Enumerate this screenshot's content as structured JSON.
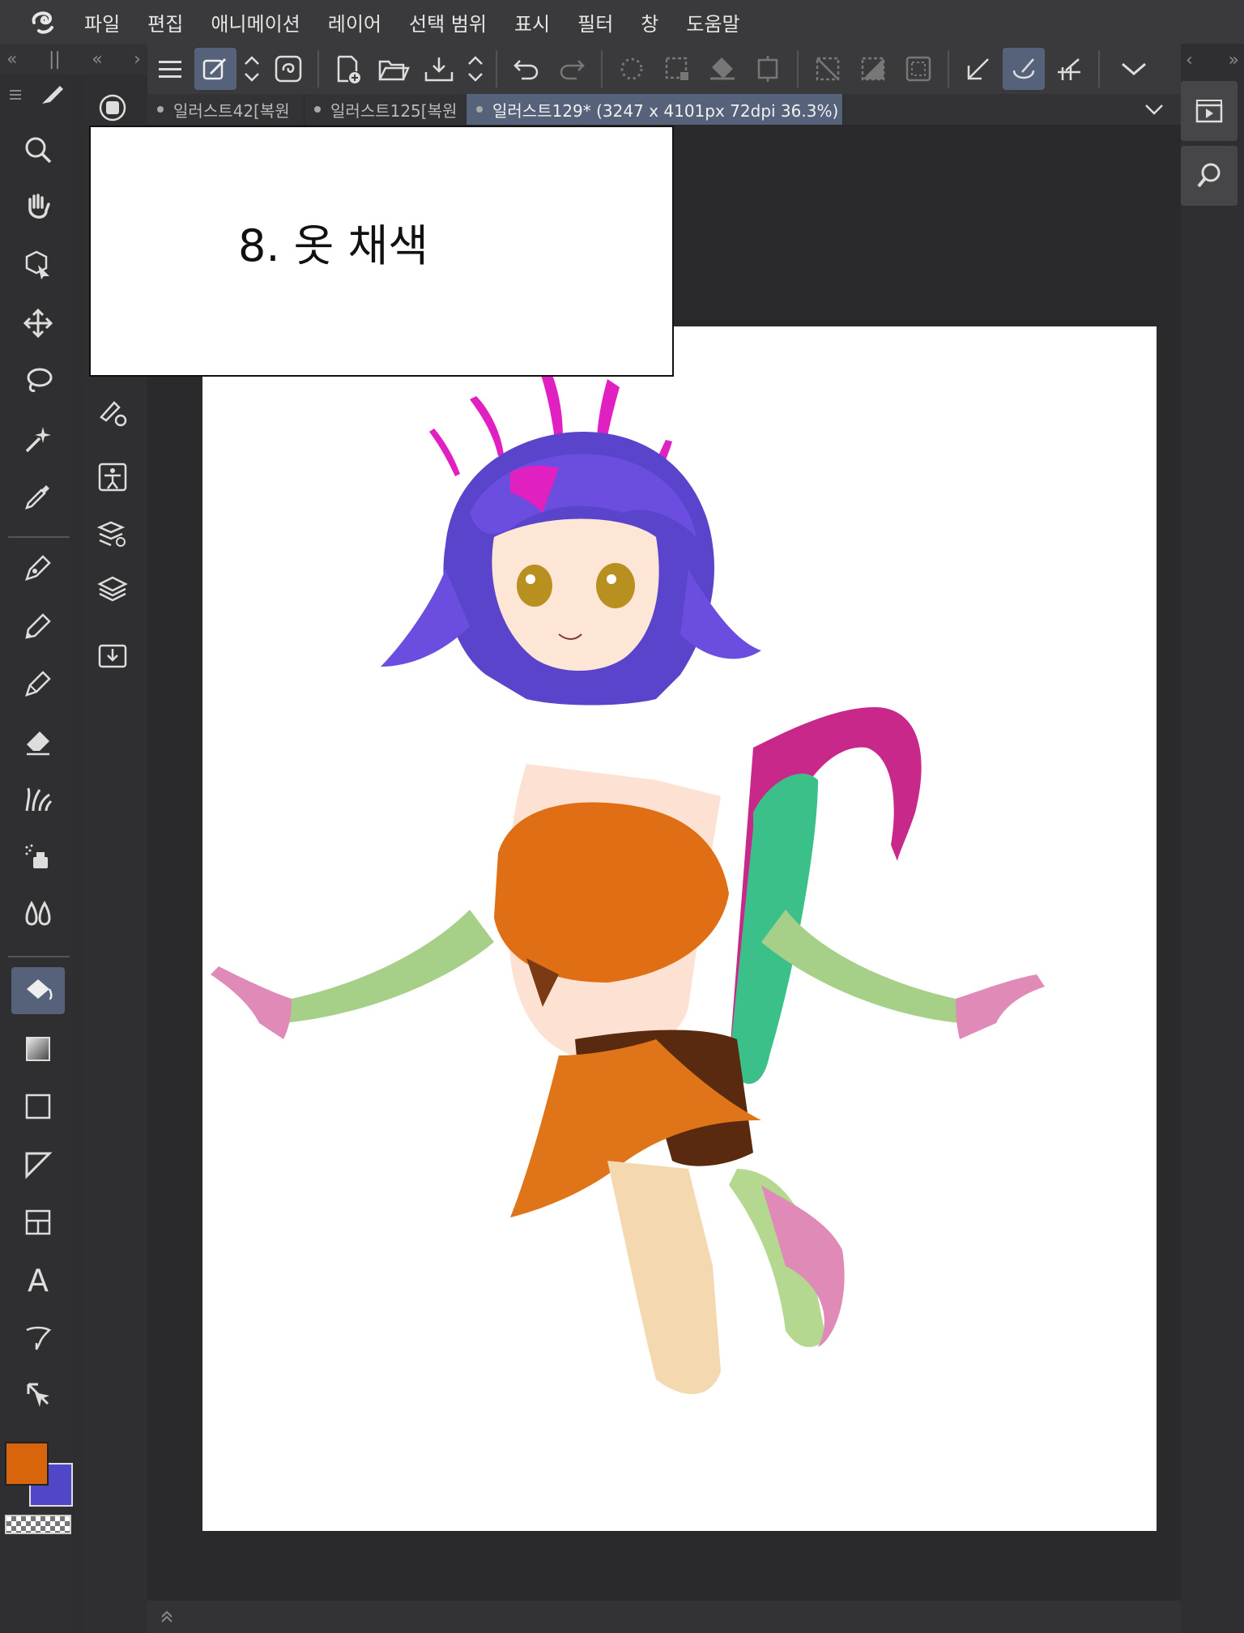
{
  "menu": {
    "items": [
      "파일",
      "편집",
      "애니메이션",
      "레이어",
      "선택 범위",
      "표시",
      "필터",
      "창",
      "도움말"
    ]
  },
  "panel_headers": {
    "left_collapse": "«",
    "left_grip": "||",
    "left_collapse2": "«",
    "left_expand": "›",
    "right_prev": "‹",
    "right_expand": "»",
    "bottom_expand": "»"
  },
  "tabs": [
    {
      "label": "일러스트42[복원"
    },
    {
      "label": "일러스트125[복원"
    },
    {
      "label": "일러스트129* (3247 x 4101px 72dpi 36.3%)"
    }
  ],
  "caption": {
    "text": "8. 옷 채색"
  },
  "colors": {
    "main": "#d8640c",
    "sub": "#4f46c8",
    "accent": "#56617a"
  },
  "toolbar_icons": [
    "menu-icon",
    "companion-icon",
    "up-down-icon",
    "clip-studio-icon",
    "new-file-icon",
    "open-icon",
    "save-icon",
    "up-down-icon",
    "undo-icon",
    "redo-icon",
    "busy-icon",
    "selection-icon",
    "fill-icon",
    "transform-icon",
    "clear-selection-icon",
    "invert-selection-icon",
    "show-selection-icon",
    "ruler-snap-icon",
    "special-ruler-snap-icon",
    "grid-snap-icon",
    "more-icon"
  ],
  "tools": [
    "search-icon",
    "hand-icon",
    "object-icon",
    "move-icon",
    "lasso-icon",
    "magic-wand-icon",
    "eyedropper-icon",
    "pen-icon",
    "pencil-icon",
    "brush-icon",
    "eraser-icon",
    "decoration-icon",
    "airbrush-icon",
    "blend-icon",
    "fill-icon",
    "gradient-icon",
    "figure-icon",
    "ruler-icon",
    "frame-icon",
    "text-icon",
    "balloon-icon",
    "correction-icon"
  ],
  "sub_tools": [
    "navigator-icon",
    "sub-tool-icon",
    "tool-property-icon",
    "layer-property-icon",
    "layer-search-icon",
    "layer-icon",
    "material-icon"
  ]
}
